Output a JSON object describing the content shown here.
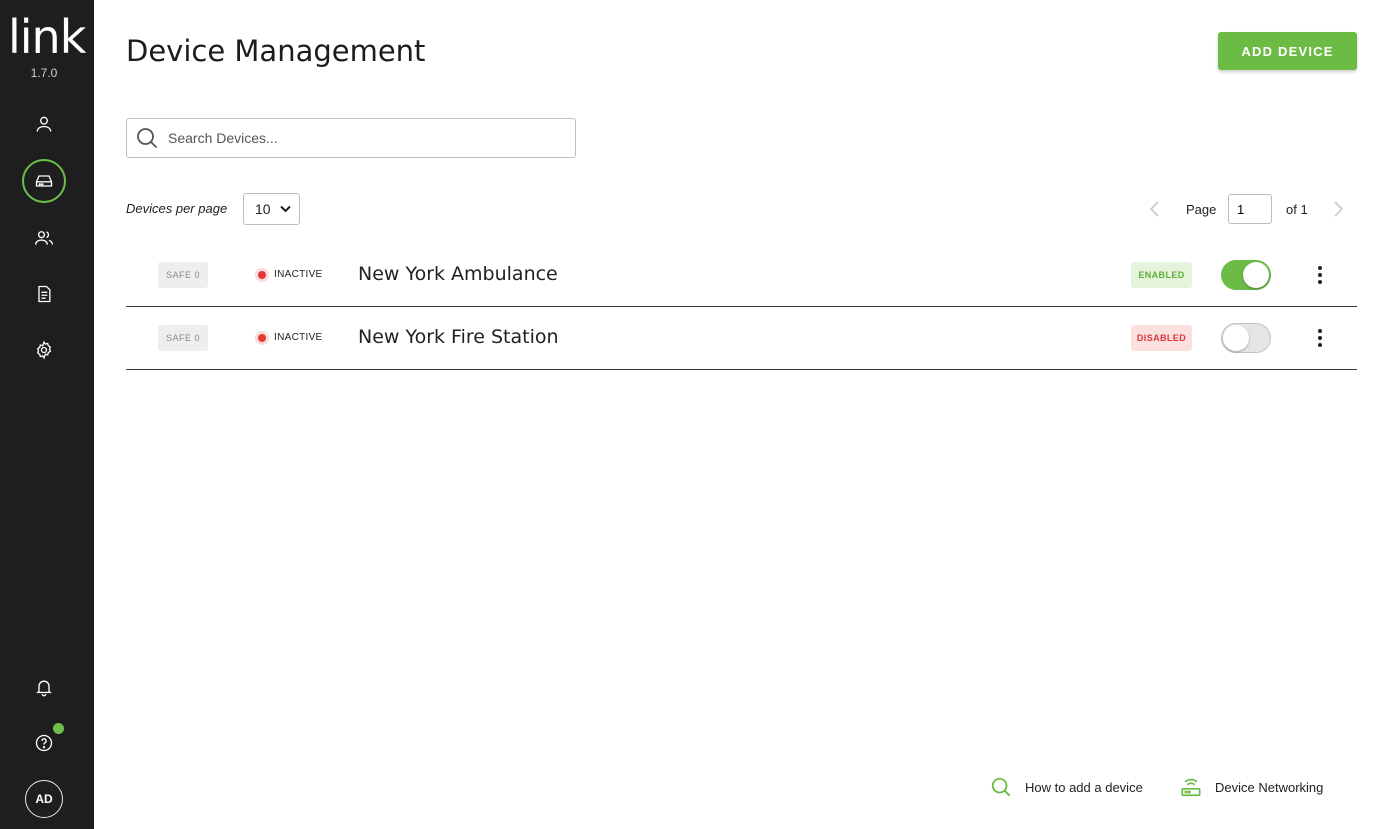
{
  "app": {
    "logo_text": "link",
    "version": "1.7.0"
  },
  "sidebar": {
    "items": [
      {
        "name": "users-icon",
        "active": false
      },
      {
        "name": "device-icon",
        "active": true
      },
      {
        "name": "groups-icon",
        "active": false
      },
      {
        "name": "document-icon",
        "active": false
      },
      {
        "name": "gear-icon",
        "active": false
      }
    ],
    "bottom": {
      "notifications_icon": "bell-icon",
      "help_icon": "help-icon",
      "avatar_initials": "AD"
    }
  },
  "header": {
    "title": "Device Management",
    "add_button_label": "ADD DEVICE"
  },
  "search": {
    "placeholder": "Search Devices...",
    "value": ""
  },
  "pagination": {
    "per_page_label": "Devices per page",
    "per_page_value": "10",
    "page_label": "Page",
    "current_page": "1",
    "of_label": "of 1"
  },
  "devices": [
    {
      "safe_label": "SAFE 0",
      "status": "INACTIVE",
      "name": "New York Ambulance",
      "state": "ENABLED",
      "enabled": true
    },
    {
      "safe_label": "SAFE 0",
      "status": "INACTIVE",
      "name": "New York Fire Station",
      "state": "DISABLED",
      "enabled": false
    }
  ],
  "footer": {
    "how_to_label": "How to add a device",
    "networking_label": "Device Networking"
  },
  "colors": {
    "accent": "#6cbb45",
    "sidebar_bg": "#1e1e1e",
    "inactive_dot": "#e53935",
    "disabled_text": "#d9363b"
  }
}
